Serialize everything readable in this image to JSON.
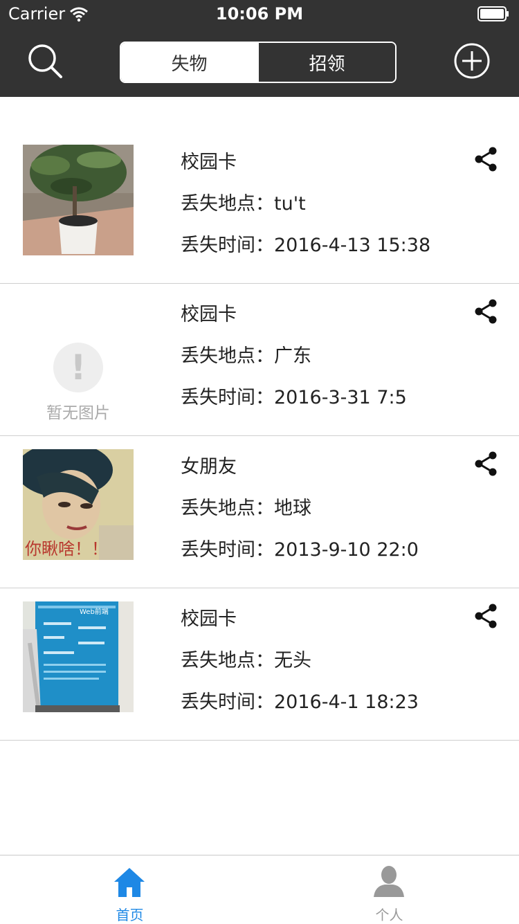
{
  "status": {
    "carrier": "Carrier",
    "time": "10:06 PM"
  },
  "nav": {
    "search_icon": "search-icon",
    "add_icon": "plus-circle-icon",
    "segments": [
      {
        "label": "失物",
        "active": true
      },
      {
        "label": "招领",
        "active": false
      }
    ]
  },
  "colors": {
    "nav_bg": "#333333",
    "accent": "#1E88E5",
    "inactive_tab": "#999999"
  },
  "items": [
    {
      "title": "校园卡",
      "place": "丢失地点：tu't",
      "time": "丢失时间：2016-4-13 15:38",
      "image": "plant-photo"
    },
    {
      "title": "校园卡",
      "place": "丢失地点：广东",
      "time": "丢失时间：2016-3-31 7:5",
      "image": "none",
      "no_image_text": "暂无图片",
      "no_image_glyph": "!"
    },
    {
      "title": "女朋友",
      "place": "丢失地点：地球",
      "time": "丢失时间：2013-9-10 22:0",
      "image": "portrait-photo",
      "image_caption": "你瞅啥！！"
    },
    {
      "title": "校园卡",
      "place": "丢失地点：无头",
      "time": "丢失时间：2016-4-1 18:23",
      "image": "poster-photo",
      "poster_text": "Web前端"
    }
  ],
  "tabbar": [
    {
      "label": "首页",
      "icon": "home-icon",
      "active": true
    },
    {
      "label": "个人",
      "icon": "person-icon",
      "active": false
    }
  ]
}
